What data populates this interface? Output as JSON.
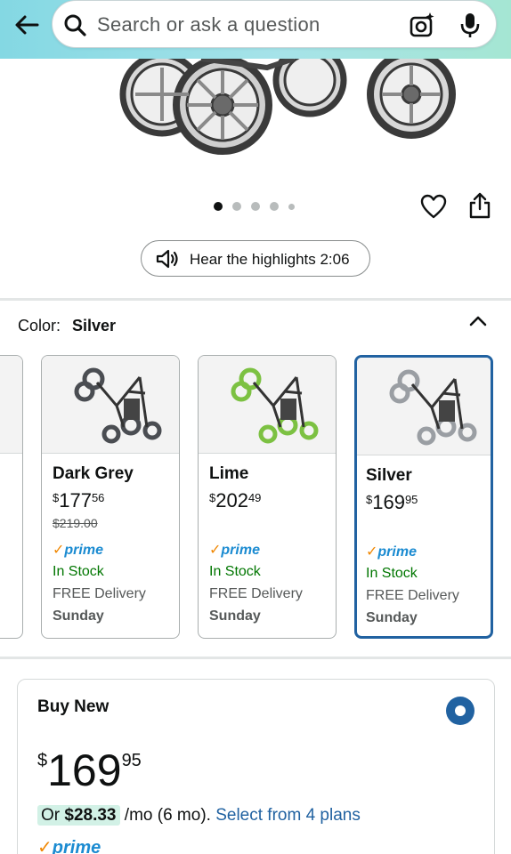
{
  "search": {
    "placeholder": "Search or ask a question"
  },
  "gallery": {
    "dot_count": 5,
    "active_dot": 0
  },
  "highlights": {
    "label": "Hear the highlights 2:06"
  },
  "color": {
    "label": "Color:",
    "value": "Silver"
  },
  "swatches": [
    {
      "name": "Dark Grey",
      "currency": "$",
      "price_whole": "177",
      "price_fraction": "56",
      "list_price": "$219.00",
      "prime": "prime",
      "stock": "In Stock",
      "delivery": "FREE Delivery",
      "day": "Sunday",
      "selected": false,
      "accent": "#4a4d52"
    },
    {
      "name": "Lime",
      "currency": "$",
      "price_whole": "202",
      "price_fraction": "49",
      "list_price": "",
      "prime": "prime",
      "stock": "In Stock",
      "delivery": "FREE Delivery",
      "day": "Sunday",
      "selected": false,
      "accent": "#7cc142"
    },
    {
      "name": "Silver",
      "currency": "$",
      "price_whole": "169",
      "price_fraction": "95",
      "list_price": "",
      "prime": "prime",
      "stock": "In Stock",
      "delivery": "FREE Delivery",
      "day": "Sunday",
      "selected": true,
      "accent": "#9a9ea3"
    }
  ],
  "buy_new": {
    "title": "Buy New",
    "currency": "$",
    "price_whole": "169",
    "price_fraction": "95",
    "plan_prefix": "Or",
    "plan_amount": "$28.33",
    "plan_suffix": "/mo (6 mo).",
    "plan_link": "Select from 4 plans",
    "prime": "prime"
  },
  "colors": {
    "link": "#2162a1",
    "prime": "#1b8bd1",
    "in_stock": "#007600",
    "selected_border": "#2162a1",
    "header_gradient_start": "#84d8e3",
    "header_gradient_end": "#a5e6d3"
  }
}
